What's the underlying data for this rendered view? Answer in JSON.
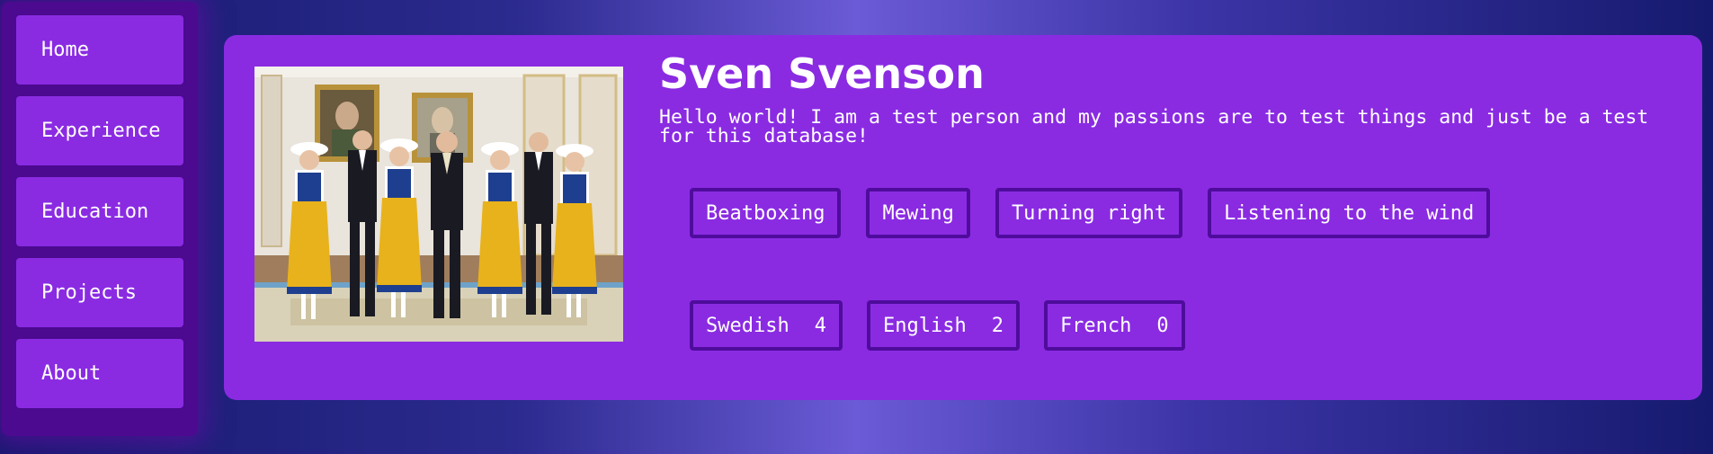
{
  "nav": {
    "items": [
      {
        "label": "Home"
      },
      {
        "label": "Experience"
      },
      {
        "label": "Education"
      },
      {
        "label": "Projects"
      },
      {
        "label": "About"
      }
    ]
  },
  "profile": {
    "name": "Sven Svenson",
    "bio": "Hello world! I am a test person and my passions are to test things and just be a test for this database!",
    "photo_description": "group-photo",
    "interests": [
      {
        "label": "Beatboxing"
      },
      {
        "label": "Mewing"
      },
      {
        "label": "Turning right"
      },
      {
        "label": "Listening to the wind"
      }
    ],
    "languages": [
      {
        "name": "Swedish",
        "level": "4"
      },
      {
        "name": "English",
        "level": "2"
      },
      {
        "name": "French",
        "level": "0"
      }
    ]
  },
  "colors": {
    "card": "#8a2be2",
    "sidebar": "#4b0a8f",
    "tag_border": "#4f0c9c",
    "background_dark": "#161a6e",
    "background_light": "#6b5bd6"
  }
}
